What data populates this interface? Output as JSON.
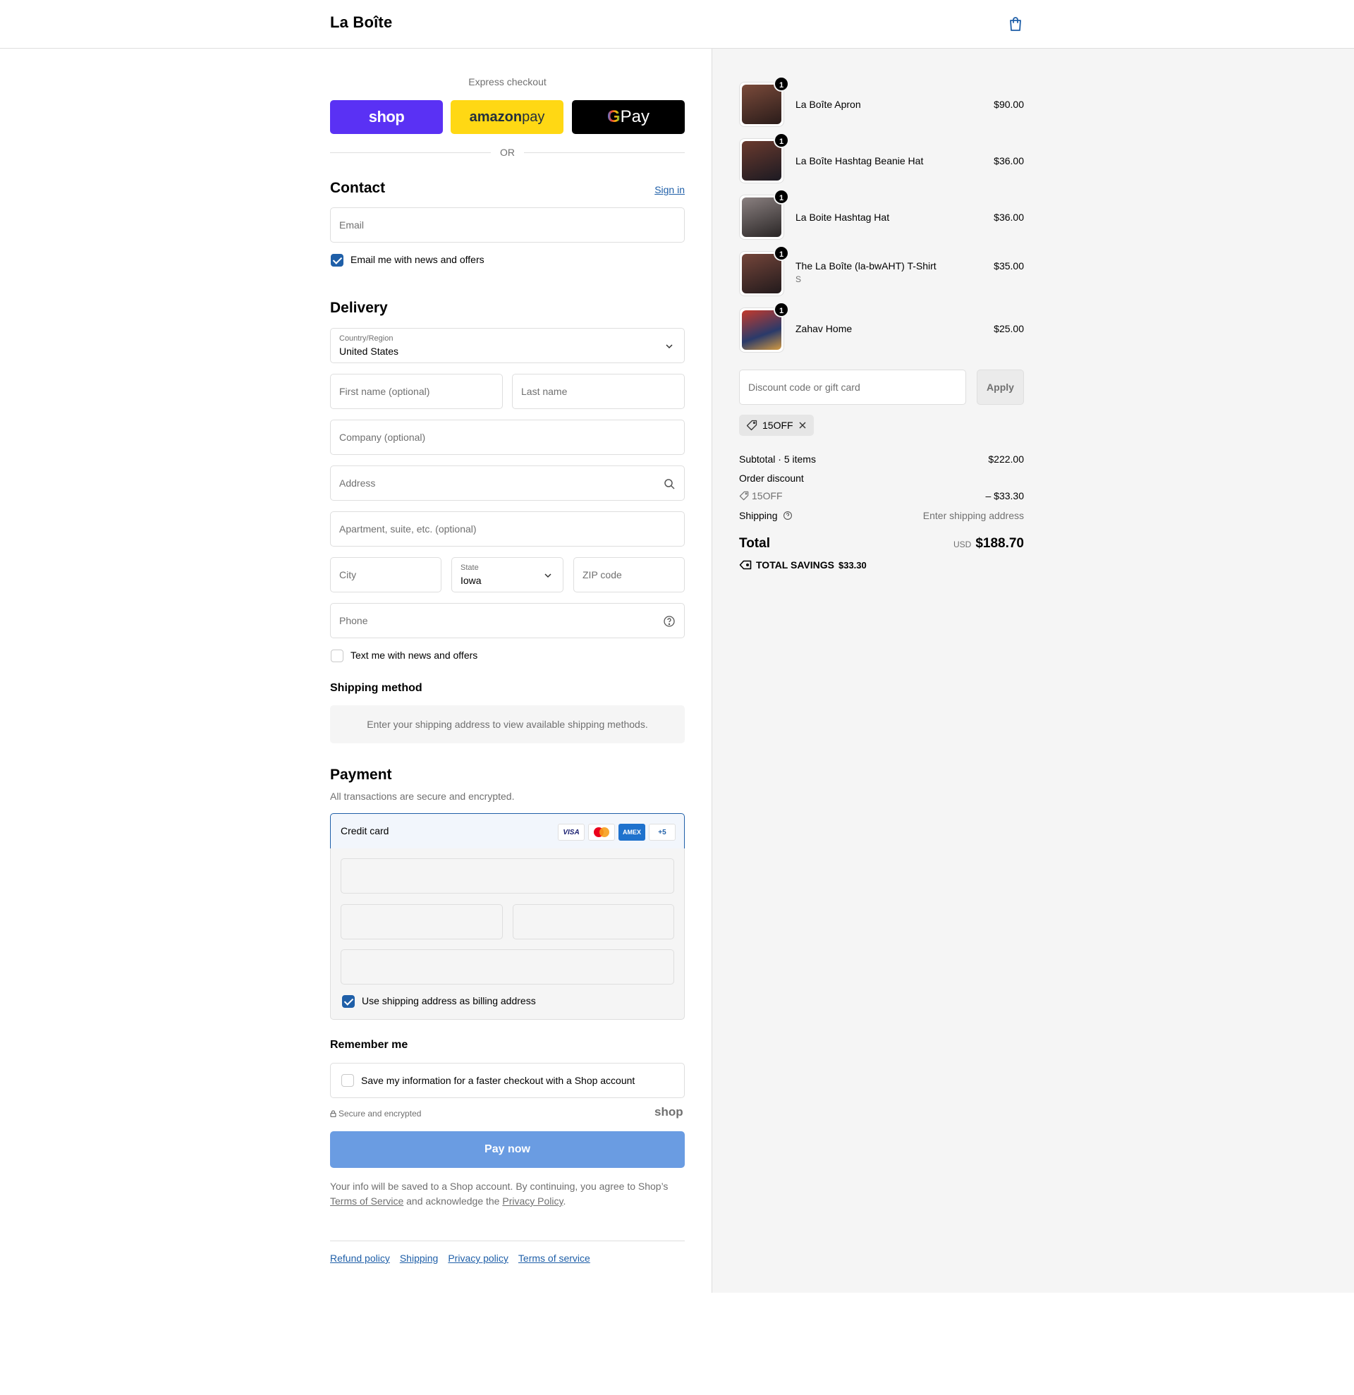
{
  "header": {
    "brand": "La Boîte",
    "cart_icon": "shopping-bag-icon"
  },
  "express": {
    "title": "Express checkout",
    "shop_label": "shop",
    "amazon_label_bold": "amazon",
    "amazon_label_rest": " pay",
    "gpay_g": "G",
    "gpay_label": " Pay",
    "or": "OR"
  },
  "contact": {
    "heading": "Contact",
    "sign_in": "Sign in",
    "email_placeholder": "Email",
    "news_checkbox": "Email me with news and offers",
    "news_checked": true
  },
  "delivery": {
    "heading": "Delivery",
    "country_label": "Country/Region",
    "country_value": "United States",
    "first_name": "First name (optional)",
    "last_name": "Last name",
    "company": "Company (optional)",
    "address": "Address",
    "apartment": "Apartment, suite, etc. (optional)",
    "city": "City",
    "state_label": "State",
    "state_value": "Iowa",
    "zip": "ZIP code",
    "phone": "Phone",
    "sms_checkbox": "Text me with news and offers",
    "sms_checked": false
  },
  "shipping_method": {
    "heading": "Shipping method",
    "message": "Enter your shipping address to view available shipping methods."
  },
  "payment": {
    "heading": "Payment",
    "subtitle": "All transactions are secure and encrypted.",
    "method": "Credit card",
    "cards": [
      "VISA",
      "MC",
      "AMEX",
      "+5"
    ],
    "billing_checkbox": "Use shipping address as billing address",
    "billing_checked": true
  },
  "remember": {
    "heading": "Remember me",
    "checkbox": "Save my information for a faster checkout with a Shop account",
    "secure": "Secure and encrypted",
    "shop_mark": "shop"
  },
  "pay_now": "Pay now",
  "legal": {
    "line1": "Your info will be saved to a Shop account. By continuing, you agree to Shop’s",
    "tos": "Terms of Service",
    "middle": " and acknowledge the ",
    "privacy": "Privacy Policy",
    "end": "."
  },
  "footer_links": [
    "Refund policy",
    "Shipping",
    "Privacy policy",
    "Terms of service"
  ],
  "cart": {
    "items": [
      {
        "name": "La Boîte Apron",
        "variant": "",
        "price": "$90.00",
        "qty": "1",
        "color": "#5a3a2e"
      },
      {
        "name": "La Boîte Hashtag Beanie Hat",
        "variant": "",
        "price": "$36.00",
        "qty": "1",
        "color": "#3b2a26"
      },
      {
        "name": "La Boite Hashtag Hat",
        "variant": "",
        "price": "$36.00",
        "qty": "1",
        "color": "#4a4444"
      },
      {
        "name": "The La Boîte (la-bwAHT) T-Shirt",
        "variant": "S",
        "price": "$35.00",
        "qty": "1",
        "color": "#47302a"
      },
      {
        "name": "Zahav Home",
        "variant": "",
        "price": "$25.00",
        "qty": "1",
        "color": "#b23a2c"
      }
    ],
    "discount_placeholder": "Discount code or gift card",
    "apply": "Apply",
    "applied_code": "15OFF",
    "subtotal_label": "Subtotal · 5 items",
    "subtotal_value": "$222.00",
    "order_discount_label": "Order discount",
    "discount_code": "15OFF",
    "discount_value": "– $33.30",
    "shipping_label": "Shipping",
    "shipping_value": "Enter shipping address",
    "total_label": "Total",
    "currency": "USD",
    "total_value": "$188.70",
    "savings_label": "TOTAL SAVINGS",
    "savings_value": "$33.30"
  },
  "colors": {
    "accent": "#1f5fa8",
    "shop_purple": "#5a31f4",
    "amazon_yellow": "#ffd814",
    "pay_button": "#6a9ce2"
  }
}
